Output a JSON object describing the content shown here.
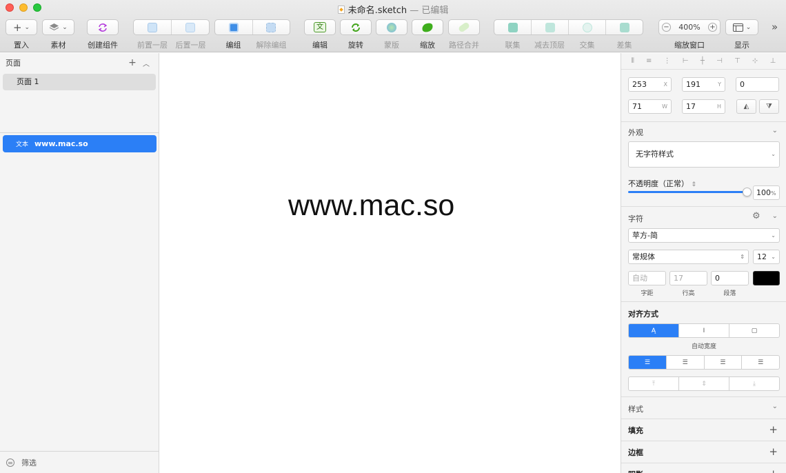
{
  "window": {
    "title": "未命名.sketch",
    "edited_suffix": " — 已编辑"
  },
  "toolbar": {
    "insert_label": "置入",
    "insert_icon": "+",
    "assets_label": "素材",
    "create_symbol_label": "创建组件",
    "forward_label": "前置一层",
    "backward_label": "后置一层",
    "group_label": "编组",
    "ungroup_label": "解除编组",
    "edit_label": "编辑",
    "rotate_label": "旋转",
    "mask_label": "蒙版",
    "scale_label": "缩放",
    "flatten_label": "路径合并",
    "union_label": "联集",
    "subtract_label": "减去顶层",
    "intersect_label": "交集",
    "difference_label": "差集",
    "zoom_value": "400%",
    "zoom_minus": "−",
    "zoom_plus": "+",
    "zoom_label": "缩放窗口",
    "view_label": "显示",
    "more": "»"
  },
  "sidebar": {
    "pages_title": "页面",
    "add_icon": "+",
    "collapse_icon": "︿",
    "pages": [
      {
        "label": "页面 1"
      }
    ],
    "layers": [
      {
        "type": "文本",
        "name": "www.mac.so"
      }
    ],
    "filter_label": "筛选"
  },
  "canvas": {
    "text": "www.mac.so"
  },
  "inspector": {
    "x": "253",
    "x_suffix": "X",
    "y": "191",
    "y_suffix": "Y",
    "rotation": "0",
    "w": "71",
    "w_suffix": "W",
    "h": "17",
    "h_suffix": "H",
    "appearance_title": "外观",
    "text_style": "无字符样式",
    "opacity_label": "不透明度（正常）",
    "opacity_value": "100",
    "opacity_unit": "%",
    "opacity_fraction": 1.0,
    "character_title": "字符",
    "font_family": "苹方-简",
    "font_weight": "常规体",
    "font_size": "12",
    "spacing_placeholder": "自动",
    "line_height_placeholder": "17",
    "paragraph": "0",
    "text_color": "#000000",
    "spacing_label": "字距",
    "line_height_label": "行高",
    "paragraph_label": "段落",
    "alignment_title": "对齐方式",
    "auto_width_label": "自动宽度",
    "style_title": "样式",
    "fill_title": "填充",
    "border_title": "边框",
    "shadow_title": "阴影"
  },
  "colors": {
    "accent": "#2b7ff6",
    "close": "#ff5f57",
    "minimize": "#febc2e",
    "zoom": "#28c840"
  }
}
